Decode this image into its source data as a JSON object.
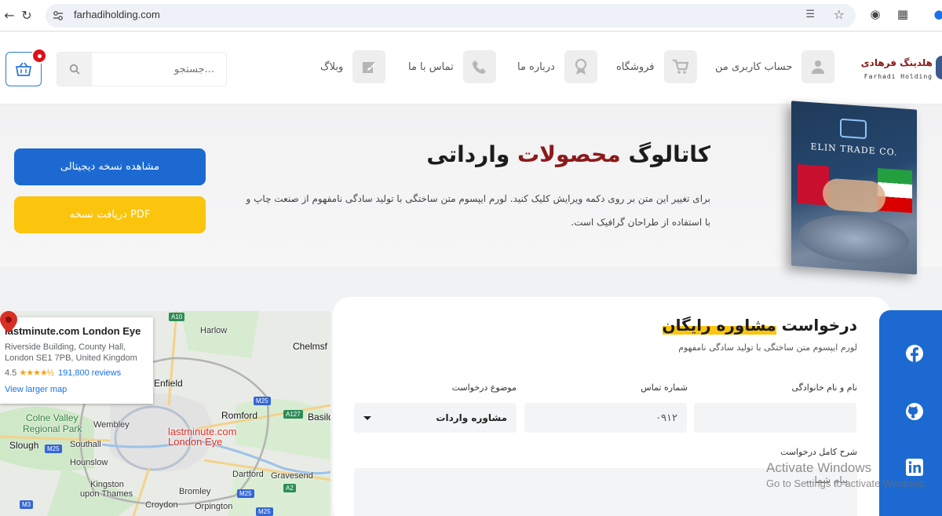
{
  "browser": {
    "url": "farhadiholding.com",
    "back_icon": "arrow-left-icon",
    "reload_icon": "reload-icon"
  },
  "header": {
    "logo_text": "هلدینگ فرهادی",
    "logo_subtext": "Farhadi Holding",
    "nav": [
      {
        "label": "حساب کاربری من",
        "icon": "user-icon"
      },
      {
        "label": "فروشگاه",
        "icon": "cart-icon"
      },
      {
        "label": "درباره ما",
        "icon": "award-icon"
      },
      {
        "label": "تماس با ما",
        "icon": "phone-icon"
      },
      {
        "label": "وبلاگ",
        "icon": "edit-icon"
      }
    ],
    "search_placeholder": "جستجو...",
    "cart_badge_color": "#e0101a"
  },
  "hero": {
    "title_part1": "کاتالوگ",
    "title_highlight": "محصولات",
    "title_part2": "وارداتی",
    "description": "برای تغییر این متن بر روی دکمه ویرایش کلیک کنید. لورم ایپسوم متن ساختگی با تولید سادگی نامفهوم از صنعت چاپ و با استفاده از طراحان گرافیک است.",
    "btn_digital": "مشاهده نسخه دیجیتالی",
    "btn_pdf": "دریافت نسخه PDF",
    "catalog_title": "ELIN TRADE CO.",
    "colors": {
      "primary": "#1c6ad1",
      "accent": "#fbc40d",
      "highlight": "#8b1a1a"
    }
  },
  "map": {
    "place_name": "lastminute.com London Eye",
    "address": "Riverside Building, County Hall, London SE1 7PB, United Kingdom",
    "rating": "4.5",
    "stars": "★★★★½",
    "reviews": "191,800 reviews",
    "larger_map": "View larger map",
    "labels": {
      "harlow": "Harlow",
      "chelmsford": "Chelmsf",
      "enfield": "Enfield",
      "romford": "Romford",
      "basildon": "Basild",
      "colne": "Colne Valley",
      "regional": "Regional Park",
      "wembley": "Wembley",
      "slough": "Slough",
      "southall": "Southall",
      "hounslow": "Hounslow",
      "kingston": "Kingston",
      "thames": "upon Thames",
      "dartford": "Dartford",
      "gravesend": "Gravesend",
      "bromley": "Bromley",
      "croydon": "Croydon",
      "orpington": "Orpington",
      "pin1": "lastminute.com",
      "pin2": "London Eye"
    },
    "roads": {
      "a10": "A10",
      "m25a": "M25",
      "a127": "A127",
      "m25b": "M25",
      "m25c": "M25",
      "m3": "M3",
      "a2": "A2",
      "m25d": "M25"
    }
  },
  "form": {
    "title": "درخواست",
    "title_highlight": "مشاوره رایگان",
    "subtitle": "لورم ایپسوم متن ساختگی با تولید سادگی نامفهوم",
    "name_label": "نام و نام خانوادگی",
    "phone_label": "شماره تماس",
    "phone_placeholder": "۰۹۱۲",
    "topic_label": "موضوع درخواست",
    "topic_value": "مشاوره واردات",
    "desc_label": "شرح کامل درخواست",
    "desc_placeholder": "پیام شما..."
  },
  "social": [
    {
      "name": "facebook-icon"
    },
    {
      "name": "github-icon"
    },
    {
      "name": "linkedin-icon"
    }
  ],
  "watermark": {
    "line1": "Activate Windows",
    "line2": "Go to Settings to activate Windows."
  }
}
